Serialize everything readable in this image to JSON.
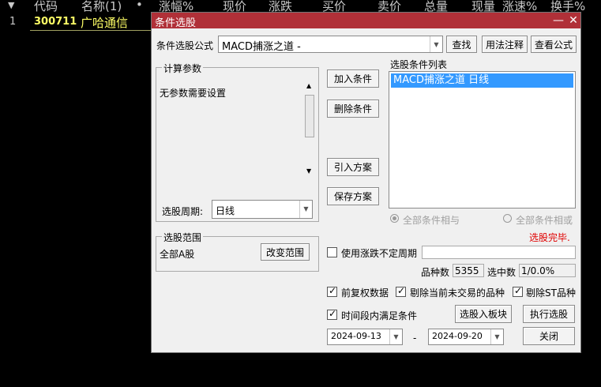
{
  "background": {
    "columns": [
      "▼",
      "代码",
      "名称(1)",
      "•",
      "涨幅%",
      "现价",
      "涨跌",
      "买价",
      "卖价",
      "总量",
      "现量",
      "涨速%",
      "换手%"
    ],
    "row": {
      "index": "1",
      "code": "300711",
      "name": "广哈通信"
    },
    "colors": {
      "header": "#c8c8c8",
      "code": "#ffff66"
    }
  },
  "dialog": {
    "title": "条件选股",
    "formula_label": "条件选股公式",
    "formula_value": "MACD捕涨之道 -",
    "find_button": "查找",
    "usage_button": "用法注释",
    "view_formula_button": "查看公式",
    "params_group_title": "计算参数",
    "params_text": "无参数需要设置",
    "period_label": "选股周期:",
    "period_value": "日线",
    "add_condition": "加入条件",
    "delete_condition": "删除条件",
    "import_plan": "引入方案",
    "save_plan": "保存方案",
    "condition_list_title": "选股条件列表",
    "condition_items": [
      "MACD捕涨之道  日线"
    ],
    "radio_and": "全部条件相与",
    "radio_or": "全部条件相或",
    "status_text": "选股完毕.",
    "range_group_title": "选股范围",
    "range_value": "全部A股",
    "change_range": "改变范围",
    "use_uncertain_label": "使用涨跌不定周期",
    "count_label": "品种数",
    "count_value": "5355",
    "selected_label": "选中数",
    "selected_value": "1/0.0%",
    "opt_pre_adjust": "前复权数据",
    "opt_remove_untraded": "剔除当前未交易的品种",
    "opt_remove_st": "剔除ST品种",
    "opt_period_satisfy": "时间段内满足条件",
    "select_to_block": "选股入板块",
    "execute": "执行选股",
    "date_start": "2024-09-13",
    "date_sep": "-",
    "date_end": "2024-09-20",
    "close": "关闭",
    "colors": {
      "title_bar": "#b03038",
      "selection": "#3399ff",
      "status": "#e00000"
    }
  }
}
